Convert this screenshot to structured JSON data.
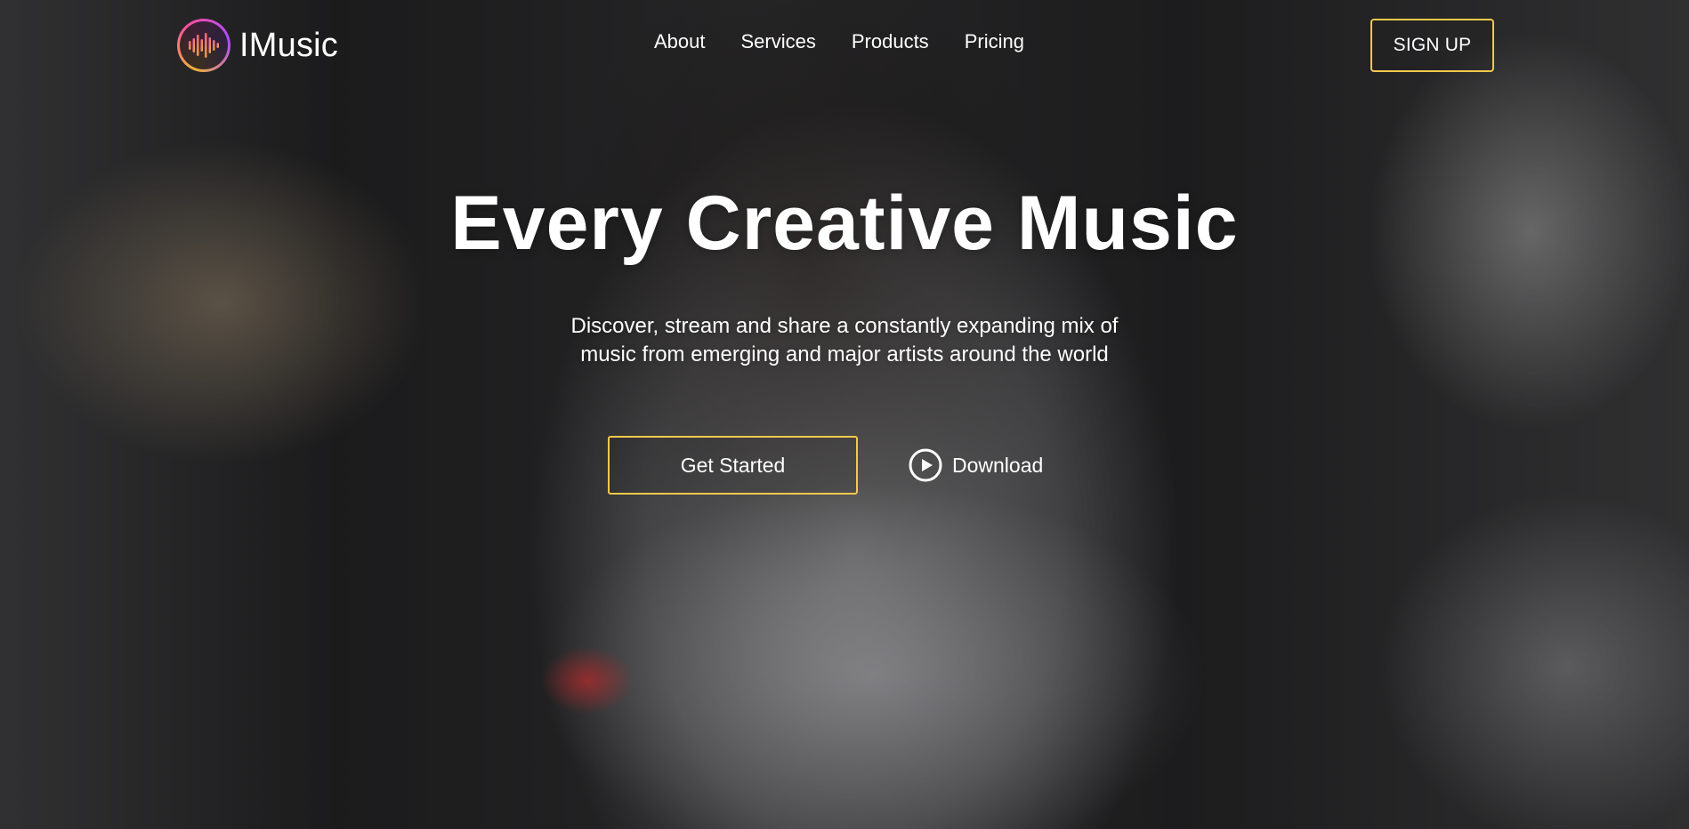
{
  "brand": {
    "name": "IMusic",
    "logo_icon": "audio-wave-icon",
    "logo_ring_colors": [
      "#f3b33a",
      "#ff4fa0",
      "#a84cff"
    ]
  },
  "nav": {
    "items": [
      {
        "label": "About"
      },
      {
        "label": "Services"
      },
      {
        "label": "Products"
      },
      {
        "label": "Pricing"
      }
    ]
  },
  "header": {
    "signup_label": "SIGN UP",
    "signup_border_color": "#f2c94c"
  },
  "hero": {
    "title": "Every Creative Music",
    "description": "Discover, stream and share a constantly expanding mix of music from emerging and major artists around the world",
    "primary_cta": "Get Started",
    "secondary_cta": "Download",
    "secondary_cta_icon": "play-circle-icon",
    "accent_color": "#f2c94c"
  }
}
